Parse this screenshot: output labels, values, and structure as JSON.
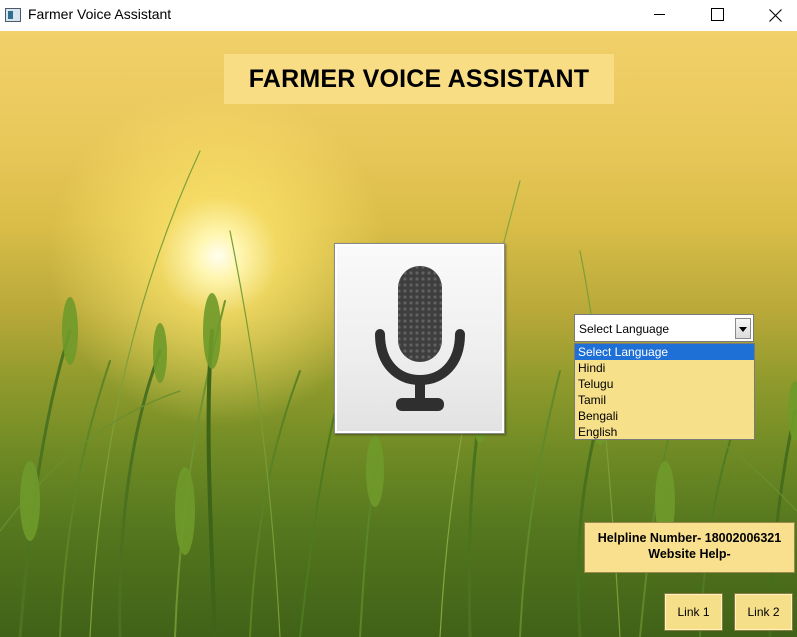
{
  "window": {
    "title": "Farmer Voice Assistant",
    "controls": {
      "minimize": "minimize-icon",
      "maximize": "maximize-icon",
      "close": "close-icon"
    }
  },
  "header": {
    "title": "FARMER VOICE ASSISTANT"
  },
  "mic": {
    "icon": "microphone-icon"
  },
  "language": {
    "selected": "Select Language",
    "options": [
      "Select Language",
      "Hindi",
      "Telugu",
      "Tamil",
      "Bengali",
      "English"
    ]
  },
  "helpline": {
    "number_line": "Helpline Number- 18002006321",
    "website_line": "Website Help-"
  },
  "links": {
    "link1": "Link 1",
    "link2": "Link 2"
  },
  "colors": {
    "panel": "#f8e08e",
    "selection": "#1e6fd6",
    "title_bar": "#ffffff"
  }
}
